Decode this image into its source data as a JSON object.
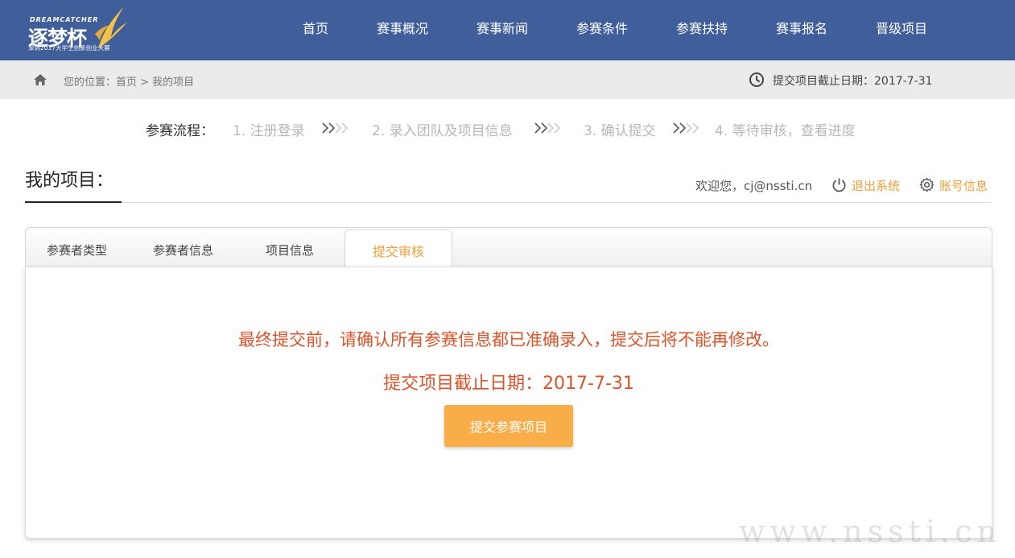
{
  "logo": {
    "en": "DREAMCATCHER",
    "cn": "逐梦杯",
    "subtitle": "深圳2017大学生创新创业大赛"
  },
  "nav": [
    "首页",
    "赛事概况",
    "赛事新闻",
    "参赛条件",
    "参赛扶持",
    "赛事报名",
    "晋级项目"
  ],
  "breadcrumb": {
    "icon": "home-icon",
    "text": "您的位置：首页 > 我的项目",
    "deadline_icon": "clock-icon",
    "deadline": "提交项目截止日期：2017-7-31"
  },
  "process": {
    "label": "参赛流程：",
    "steps": [
      "1. 注册登录",
      "2. 录入团队及项目信息",
      "3. 确认提交",
      "4. 等待审核，查看进度"
    ]
  },
  "page": {
    "title": "我的项目：",
    "welcome": "欢迎您，cj@nssti.cn",
    "logout": "退出系统",
    "account": "账号信息"
  },
  "tabs": {
    "items": [
      "参赛者类型",
      "参赛者信息",
      "项目信息"
    ],
    "active": "提交审核"
  },
  "panel": {
    "warning": "最终提交前，请确认所有参赛信息都已准确录入，提交后将不能再修改。",
    "deadline": "提交项目截止日期：2017-7-31",
    "submit_label": "提交参赛项目"
  },
  "watermark": "www.nssti.cn",
  "colors": {
    "header_bg": "#3f5e9a",
    "accent": "#f0a03c",
    "warning": "#d9532b",
    "button": "#f8ad49"
  }
}
